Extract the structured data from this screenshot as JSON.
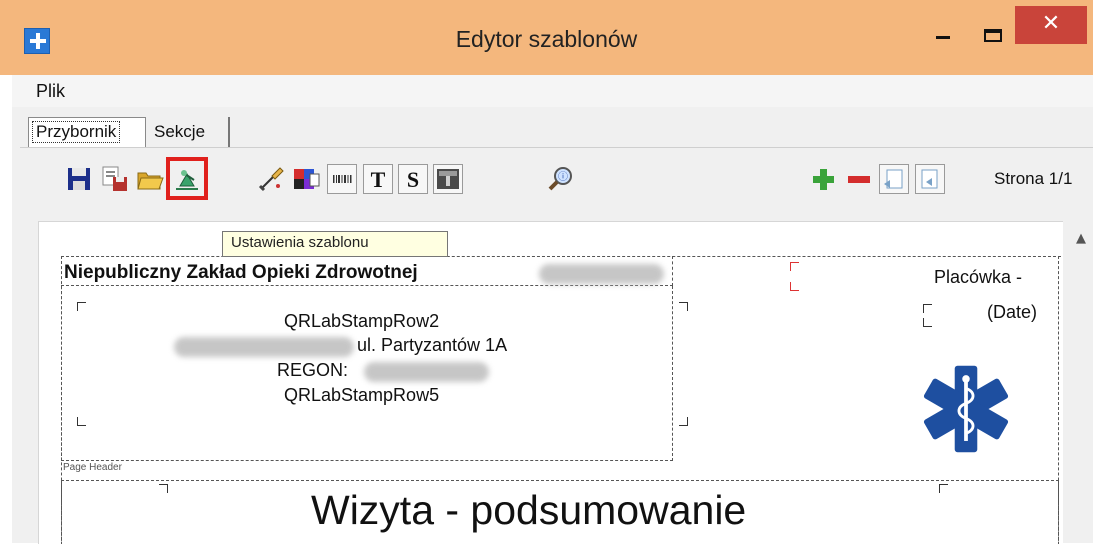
{
  "window": {
    "title": "Edytor szablonów",
    "close_glyph": "✕"
  },
  "menu": {
    "file": "Plik"
  },
  "tabs": [
    {
      "label": "Przybornik",
      "active": true
    },
    {
      "label": "Sekcje",
      "active": false
    }
  ],
  "toolbar": {
    "buttons": [
      "save-icon",
      "save-as-icon",
      "open-folder-icon",
      "template-settings-icon",
      "edit-brush-icon",
      "color-palette-icon",
      "barcode-icon",
      "text-t-icon",
      "text-s-icon",
      "text-field-icon",
      "preview-zoom-icon",
      "add-page-icon",
      "remove-page-icon",
      "previous-page-icon",
      "next-page-icon"
    ],
    "highlighted": "template-settings-icon",
    "highlight_color": "#e0201c",
    "page_indicator": "Strona 1/1"
  },
  "tooltip": "Ustawienia szablonu",
  "document": {
    "clinic_name": "Niepubliczny Zakład Opieki Zdrowotnej",
    "stamp_row2": "QRLabStampRow2",
    "address": "ul. Partyzantów 1A",
    "regon_label": "REGON:",
    "stamp_row5": "QRLabStampRow5",
    "placowka": "Placówka -",
    "date": "(Date)",
    "section_label": "Page Header",
    "report_title": "Wizyta - podsumowanie",
    "logo": "star-of-life-icon",
    "logo_color": "#1e4fa0"
  }
}
